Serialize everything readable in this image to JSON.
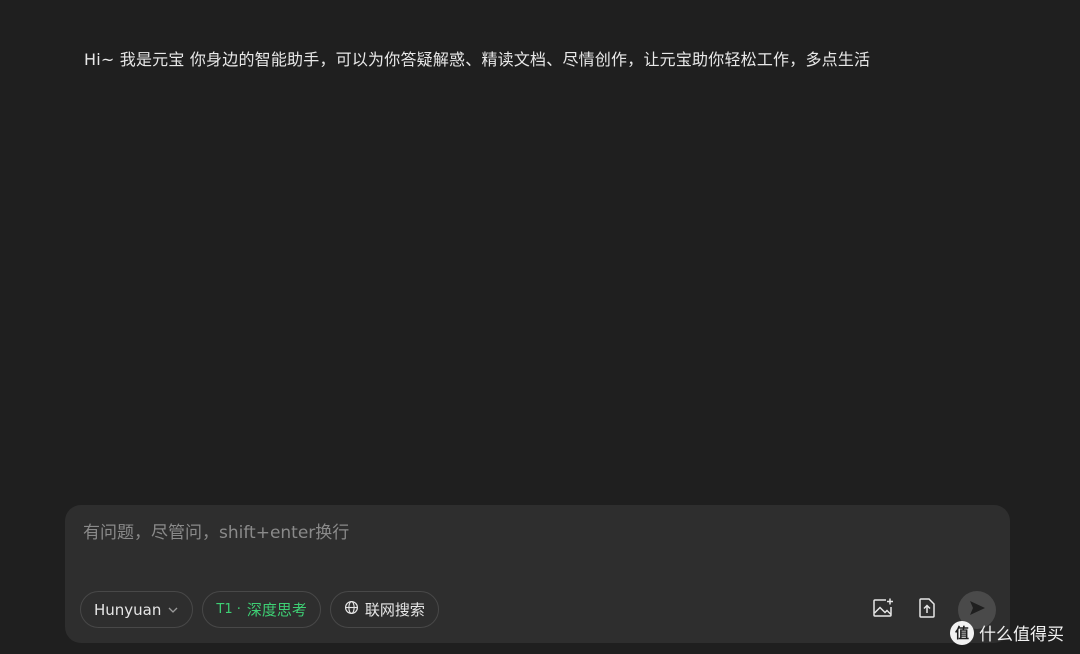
{
  "greeting": {
    "text": "Hi~ 我是元宝 你身边的智能助手，可以为你答疑解惑、精读文档、尽情创作，让元宝助你轻松工作，多点生活"
  },
  "composer": {
    "placeholder": "有问题，尽管问，shift+enter换行",
    "value": "",
    "model_selector": {
      "label": "Hunyuan",
      "icon": "chevron-down-icon"
    },
    "deep_think": {
      "prefix": "T1 ·",
      "label": "深度思考",
      "color": "#3ecf74"
    },
    "web_search": {
      "label": "联网搜索",
      "icon": "globe-icon"
    },
    "actions": {
      "image_upload_icon": "image-plus-icon",
      "file_upload_icon": "file-upload-icon",
      "send_icon": "send-icon"
    }
  },
  "watermark": {
    "logo_text": "值",
    "text": "什么值得买"
  },
  "colors": {
    "background": "#1f1f1f",
    "composer_bg": "#2e2e2e",
    "accent_green": "#3ecf74"
  }
}
